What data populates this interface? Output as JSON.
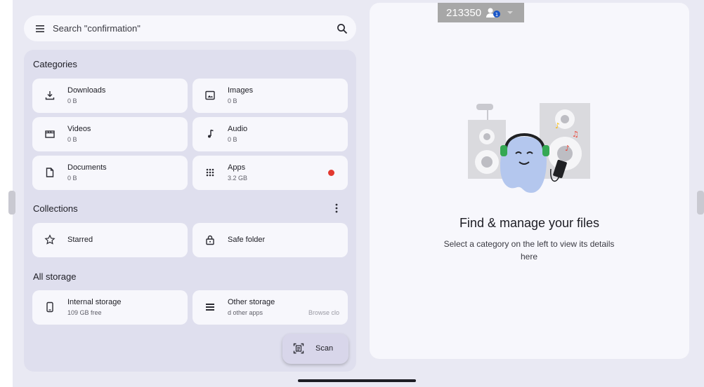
{
  "search": {
    "placeholder": "Search \"confirmation\""
  },
  "sections": {
    "categories": "Categories",
    "collections": "Collections",
    "storage": "All storage"
  },
  "categories": [
    {
      "name": "Downloads",
      "size": "0 B",
      "icon": "download-icon"
    },
    {
      "name": "Images",
      "size": "0 B",
      "icon": "image-icon"
    },
    {
      "name": "Videos",
      "size": "0 B",
      "icon": "video-icon"
    },
    {
      "name": "Audio",
      "size": "0 B",
      "icon": "music-note-icon"
    },
    {
      "name": "Documents",
      "size": "0 B",
      "icon": "document-icon"
    },
    {
      "name": "Apps",
      "size": "3.2 GB",
      "icon": "apps-grid-icon",
      "badge_color": "#e2382f"
    }
  ],
  "collections": [
    {
      "name": "Starred",
      "icon": "star-icon"
    },
    {
      "name": "Safe folder",
      "icon": "lock-icon"
    }
  ],
  "storage": [
    {
      "name": "Internal storage",
      "detail": "109 GB free",
      "icon": "phone-icon"
    },
    {
      "name": "Other storage",
      "detail": "d other apps",
      "action": "Browse clo",
      "icon": "list-icon"
    }
  ],
  "fab": {
    "label": "Scan",
    "icon": "scan-icon"
  },
  "empty_state": {
    "title": "Find & manage your files",
    "subtitle": "Select a category on the left to view its details here"
  },
  "overlay": {
    "user_id": "213350",
    "badge": "1"
  },
  "colors": {
    "accent": "#dfdfee",
    "badge": "#e2382f",
    "overlay": "#a7a7a7"
  }
}
